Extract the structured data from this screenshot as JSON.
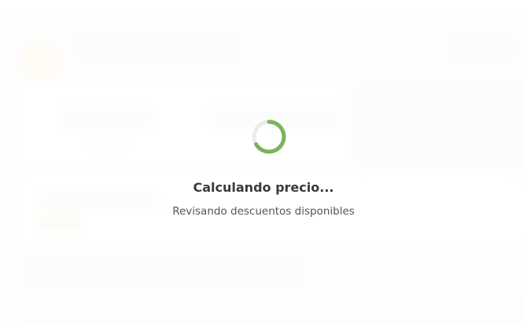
{
  "loading": {
    "title": "Calculando precio...",
    "subtitle": "Revisando descuentos disponibles",
    "spinner_color": "#7bb35a",
    "spinner_track_color": "#e9efe4"
  },
  "background": {
    "state": "blurred",
    "accent_color": "#f1c560"
  }
}
